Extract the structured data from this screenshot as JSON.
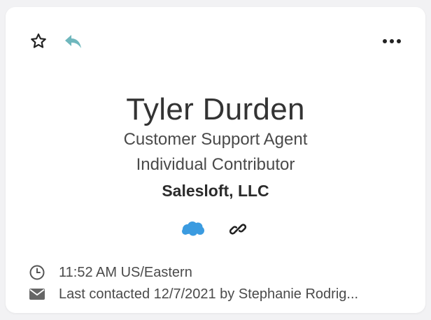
{
  "contact": {
    "name": "Tyler Durden",
    "job_title": "Customer Support Agent",
    "role": "Individual Contributor",
    "company": "Salesloft, LLC"
  },
  "details": {
    "local_time": "11:52 AM US/Eastern",
    "last_contacted": "Last contacted 12/7/2021 by Stephanie Rodrig..."
  },
  "icons": {
    "star": "star-outline-icon",
    "reply": "reply-arrow-icon",
    "more": "more-horizontal-icon",
    "crm": "salesforce-cloud-icon",
    "link": "link-chain-icon",
    "clock": "clock-icon",
    "mail": "envelope-icon"
  },
  "colors": {
    "reply_teal": "#6fb7bd",
    "salesforce_blue": "#3b9be0",
    "icon_dark": "#222222",
    "text": "#4a4a4a"
  }
}
